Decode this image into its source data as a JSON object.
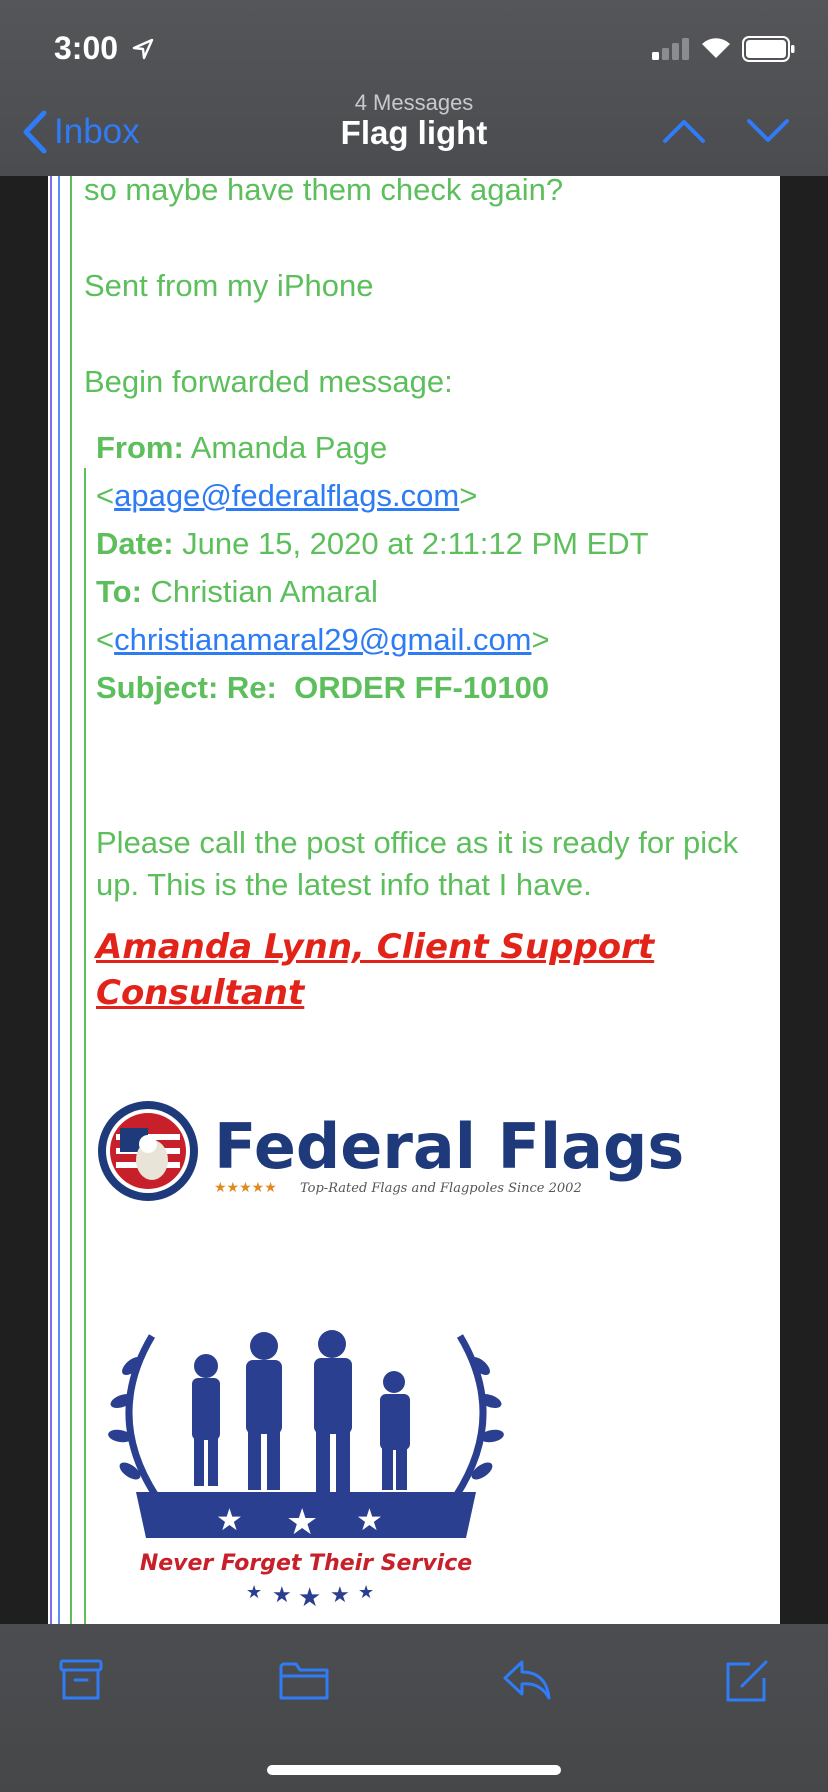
{
  "status": {
    "time": "3:00"
  },
  "nav": {
    "back_label": "Inbox",
    "count": "4 Messages",
    "title": "Flag light"
  },
  "email": {
    "partial_line": "so maybe have them check again?",
    "sent_from": "Sent from my iPhone",
    "forward_intro": "Begin forwarded message:",
    "forwarded": {
      "from_label": "From:",
      "from_name": "Amanda Page",
      "from_email": "apage@federalflags.com",
      "date_label": "Date:",
      "date_value": "June 15, 2020 at 2:11:12 PM EDT",
      "to_label": "To:",
      "to_name": "Christian Amaral",
      "to_email": "christianamaral29@gmail.com",
      "subject_label": "Subject:",
      "subject_value": "Re:  ORDER FF-10100",
      "body": "Please call the post office as it is ready for pick up. This is the latest info that I have.",
      "signature": "Amanda Lynn, Client Support Consultant"
    },
    "logo_text": "Federal Flags",
    "logo_tagline": "Top-Rated Flags and Flagpoles Since 2002",
    "badge_text": "Never Forget Their Service"
  },
  "toolbar": {
    "icons": [
      "archive-icon",
      "folder-icon",
      "reply-icon",
      "compose-icon"
    ]
  },
  "colors": {
    "accent": "#2f7cf6",
    "quote_green": "#5cbf5c",
    "signature_red": "#e2231a",
    "brand_navy": "#1f3a7a"
  }
}
